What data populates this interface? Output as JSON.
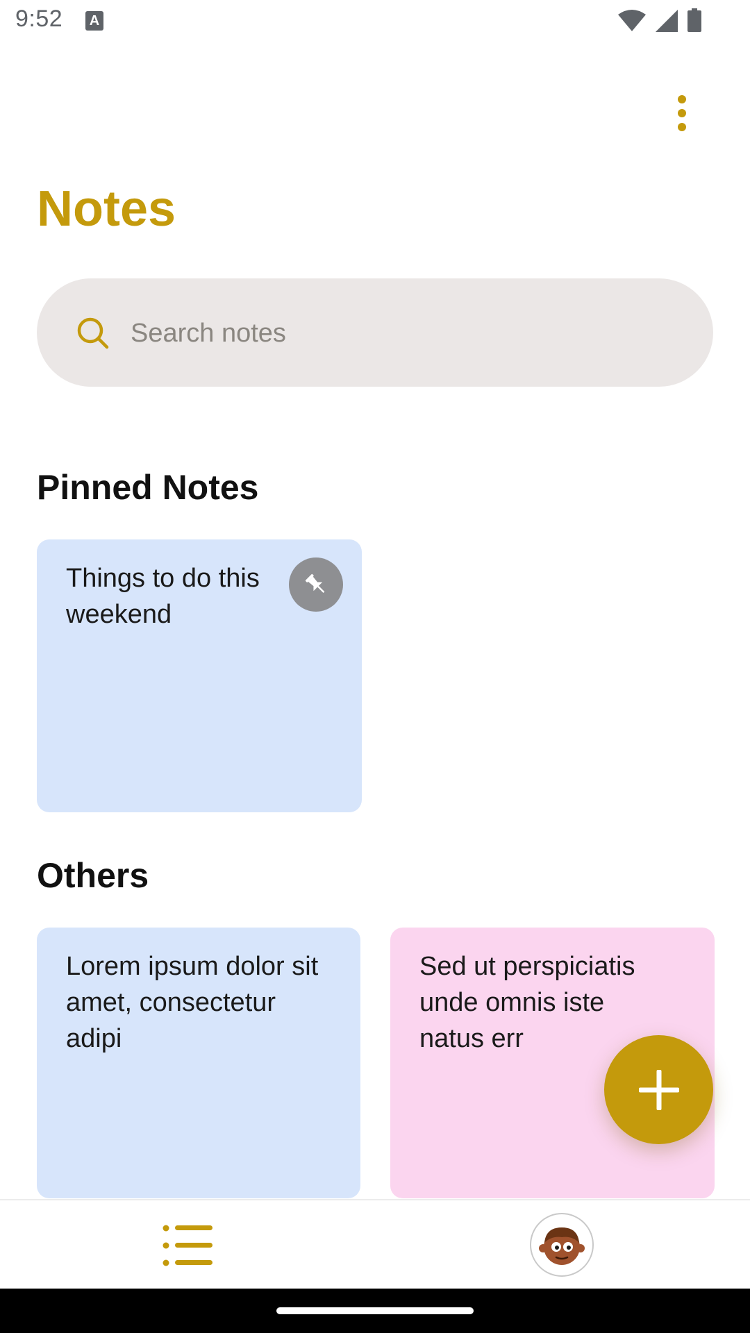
{
  "status_bar": {
    "time": "9:52",
    "keyboard_indicator": "A",
    "icons": [
      "wifi-icon",
      "signal-icon",
      "battery-icon"
    ]
  },
  "header": {
    "title": "Notes",
    "menu_icon": "more-vert-icon"
  },
  "search": {
    "placeholder": "Search notes",
    "value": "",
    "icon": "search-icon"
  },
  "pinned": {
    "heading": "Pinned Notes",
    "notes": [
      {
        "text": "Things to do this weekend",
        "color": "#d7e5fb",
        "pinned": true
      }
    ]
  },
  "others": {
    "heading": "Others",
    "notes": [
      {
        "text": "Lorem ipsum dolor sit amet, consectetur adipi",
        "color": "#d7e5fb"
      },
      {
        "text": "Sed ut perspiciatis unde omnis iste natus err",
        "color": "#fbd5ef"
      }
    ]
  },
  "fab": {
    "icon": "plus-icon"
  },
  "bottom_nav": {
    "items": [
      {
        "icon": "list-icon"
      },
      {
        "icon": "avatar"
      }
    ]
  },
  "colors": {
    "accent": "#c49a0c",
    "search_bg": "#ebe7e6",
    "note_blue": "#d7e5fb",
    "note_pink": "#fbd5ef"
  }
}
